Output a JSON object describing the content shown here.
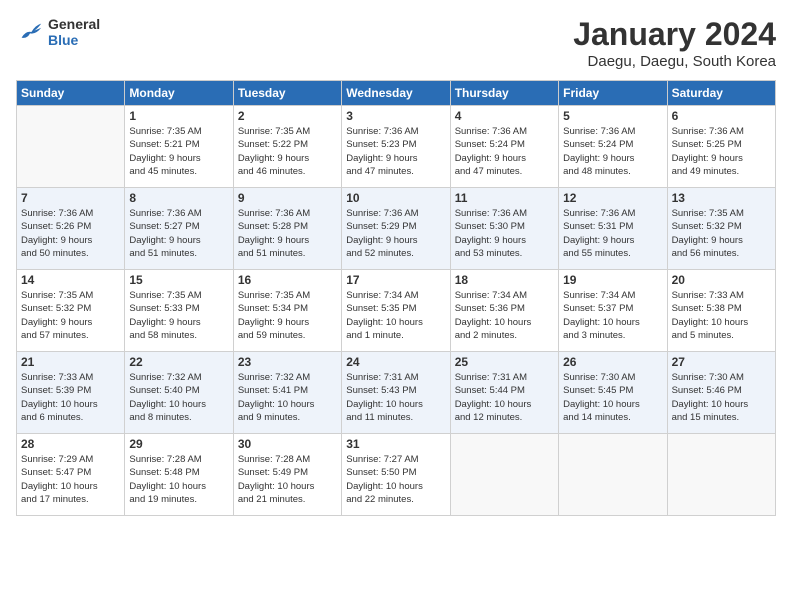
{
  "logo": {
    "line1": "General",
    "line2": "Blue"
  },
  "title": "January 2024",
  "location": "Daegu, Daegu, South Korea",
  "days_of_week": [
    "Sunday",
    "Monday",
    "Tuesday",
    "Wednesday",
    "Thursday",
    "Friday",
    "Saturday"
  ],
  "weeks": [
    [
      {
        "num": "",
        "info": ""
      },
      {
        "num": "1",
        "info": "Sunrise: 7:35 AM\nSunset: 5:21 PM\nDaylight: 9 hours\nand 45 minutes."
      },
      {
        "num": "2",
        "info": "Sunrise: 7:35 AM\nSunset: 5:22 PM\nDaylight: 9 hours\nand 46 minutes."
      },
      {
        "num": "3",
        "info": "Sunrise: 7:36 AM\nSunset: 5:23 PM\nDaylight: 9 hours\nand 47 minutes."
      },
      {
        "num": "4",
        "info": "Sunrise: 7:36 AM\nSunset: 5:24 PM\nDaylight: 9 hours\nand 47 minutes."
      },
      {
        "num": "5",
        "info": "Sunrise: 7:36 AM\nSunset: 5:24 PM\nDaylight: 9 hours\nand 48 minutes."
      },
      {
        "num": "6",
        "info": "Sunrise: 7:36 AM\nSunset: 5:25 PM\nDaylight: 9 hours\nand 49 minutes."
      }
    ],
    [
      {
        "num": "7",
        "info": "Sunrise: 7:36 AM\nSunset: 5:26 PM\nDaylight: 9 hours\nand 50 minutes."
      },
      {
        "num": "8",
        "info": "Sunrise: 7:36 AM\nSunset: 5:27 PM\nDaylight: 9 hours\nand 51 minutes."
      },
      {
        "num": "9",
        "info": "Sunrise: 7:36 AM\nSunset: 5:28 PM\nDaylight: 9 hours\nand 51 minutes."
      },
      {
        "num": "10",
        "info": "Sunrise: 7:36 AM\nSunset: 5:29 PM\nDaylight: 9 hours\nand 52 minutes."
      },
      {
        "num": "11",
        "info": "Sunrise: 7:36 AM\nSunset: 5:30 PM\nDaylight: 9 hours\nand 53 minutes."
      },
      {
        "num": "12",
        "info": "Sunrise: 7:36 AM\nSunset: 5:31 PM\nDaylight: 9 hours\nand 55 minutes."
      },
      {
        "num": "13",
        "info": "Sunrise: 7:35 AM\nSunset: 5:32 PM\nDaylight: 9 hours\nand 56 minutes."
      }
    ],
    [
      {
        "num": "14",
        "info": "Sunrise: 7:35 AM\nSunset: 5:32 PM\nDaylight: 9 hours\nand 57 minutes."
      },
      {
        "num": "15",
        "info": "Sunrise: 7:35 AM\nSunset: 5:33 PM\nDaylight: 9 hours\nand 58 minutes."
      },
      {
        "num": "16",
        "info": "Sunrise: 7:35 AM\nSunset: 5:34 PM\nDaylight: 9 hours\nand 59 minutes."
      },
      {
        "num": "17",
        "info": "Sunrise: 7:34 AM\nSunset: 5:35 PM\nDaylight: 10 hours\nand 1 minute."
      },
      {
        "num": "18",
        "info": "Sunrise: 7:34 AM\nSunset: 5:36 PM\nDaylight: 10 hours\nand 2 minutes."
      },
      {
        "num": "19",
        "info": "Sunrise: 7:34 AM\nSunset: 5:37 PM\nDaylight: 10 hours\nand 3 minutes."
      },
      {
        "num": "20",
        "info": "Sunrise: 7:33 AM\nSunset: 5:38 PM\nDaylight: 10 hours\nand 5 minutes."
      }
    ],
    [
      {
        "num": "21",
        "info": "Sunrise: 7:33 AM\nSunset: 5:39 PM\nDaylight: 10 hours\nand 6 minutes."
      },
      {
        "num": "22",
        "info": "Sunrise: 7:32 AM\nSunset: 5:40 PM\nDaylight: 10 hours\nand 8 minutes."
      },
      {
        "num": "23",
        "info": "Sunrise: 7:32 AM\nSunset: 5:41 PM\nDaylight: 10 hours\nand 9 minutes."
      },
      {
        "num": "24",
        "info": "Sunrise: 7:31 AM\nSunset: 5:43 PM\nDaylight: 10 hours\nand 11 minutes."
      },
      {
        "num": "25",
        "info": "Sunrise: 7:31 AM\nSunset: 5:44 PM\nDaylight: 10 hours\nand 12 minutes."
      },
      {
        "num": "26",
        "info": "Sunrise: 7:30 AM\nSunset: 5:45 PM\nDaylight: 10 hours\nand 14 minutes."
      },
      {
        "num": "27",
        "info": "Sunrise: 7:30 AM\nSunset: 5:46 PM\nDaylight: 10 hours\nand 15 minutes."
      }
    ],
    [
      {
        "num": "28",
        "info": "Sunrise: 7:29 AM\nSunset: 5:47 PM\nDaylight: 10 hours\nand 17 minutes."
      },
      {
        "num": "29",
        "info": "Sunrise: 7:28 AM\nSunset: 5:48 PM\nDaylight: 10 hours\nand 19 minutes."
      },
      {
        "num": "30",
        "info": "Sunrise: 7:28 AM\nSunset: 5:49 PM\nDaylight: 10 hours\nand 21 minutes."
      },
      {
        "num": "31",
        "info": "Sunrise: 7:27 AM\nSunset: 5:50 PM\nDaylight: 10 hours\nand 22 minutes."
      },
      {
        "num": "",
        "info": ""
      },
      {
        "num": "",
        "info": ""
      },
      {
        "num": "",
        "info": ""
      }
    ]
  ]
}
